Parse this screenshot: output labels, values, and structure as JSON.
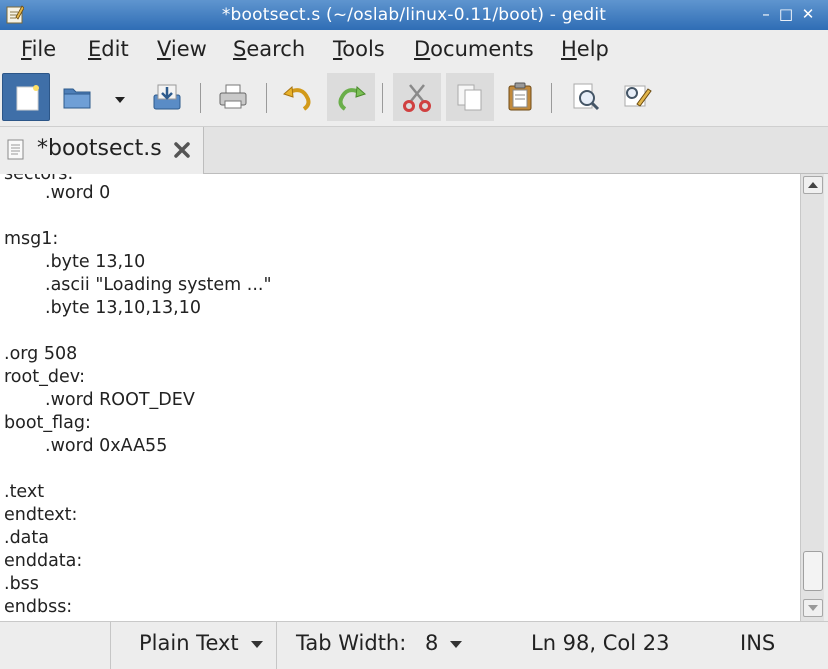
{
  "window": {
    "title": "*bootsect.s (~/oslab/linux-0.11/boot) - gedit",
    "controls": {
      "minimize": "–",
      "maximize": "□",
      "close": "✕"
    }
  },
  "menubar": {
    "items": [
      {
        "id": "file",
        "label": "File",
        "mnemonic": "F",
        "rest": "ile"
      },
      {
        "id": "edit",
        "label": "Edit",
        "mnemonic": "E",
        "rest": "dit"
      },
      {
        "id": "view",
        "label": "View",
        "mnemonic": "V",
        "rest": "iew"
      },
      {
        "id": "search",
        "label": "Search",
        "mnemonic": "S",
        "rest": "earch"
      },
      {
        "id": "tools",
        "label": "Tools",
        "mnemonic": "T",
        "rest": "ools"
      },
      {
        "id": "documents",
        "label": "Documents",
        "mnemonic": "D",
        "rest": "ocuments"
      },
      {
        "id": "help",
        "label": "Help",
        "mnemonic": "H",
        "rest": "elp"
      }
    ]
  },
  "toolbar": {
    "buttons": [
      {
        "id": "new",
        "icon": "new-document-icon",
        "active": true
      },
      {
        "id": "open",
        "icon": "open-folder-icon",
        "active": false
      },
      {
        "id": "open-recent",
        "icon": "dropdown-arrow-icon",
        "active": false
      },
      {
        "id": "save",
        "icon": "save-download-icon",
        "active": false
      },
      {
        "id": "print",
        "icon": "printer-icon",
        "active": false
      },
      {
        "id": "undo",
        "icon": "undo-arrow-icon",
        "active": false
      },
      {
        "id": "redo",
        "icon": "redo-arrow-icon",
        "active": false
      },
      {
        "id": "cut",
        "icon": "scissors-icon",
        "active": false
      },
      {
        "id": "copy",
        "icon": "copy-icon",
        "active": false
      },
      {
        "id": "paste",
        "icon": "clipboard-icon",
        "active": false
      },
      {
        "id": "find",
        "icon": "magnifier-icon",
        "active": false
      },
      {
        "id": "replace",
        "icon": "find-replace-icon",
        "active": false
      }
    ]
  },
  "tab": {
    "label": "*bootsect.s",
    "icon": "text-file-icon",
    "close_icon": "close-x-icon"
  },
  "editor": {
    "partial_top_line": "sectors:",
    "lines": [
      {
        "text": ".word 0",
        "indent": true
      },
      {
        "text": "",
        "indent": false
      },
      {
        "text": "msg1:",
        "indent": false
      },
      {
        "text": ".byte 13,10",
        "indent": true
      },
      {
        "text": ".ascii \"Loading system ...\"",
        "indent": true
      },
      {
        "text": ".byte 13,10,13,10",
        "indent": true
      },
      {
        "text": "",
        "indent": false
      },
      {
        "text": ".org 508",
        "indent": false
      },
      {
        "text": "root_dev:",
        "indent": false
      },
      {
        "text": ".word ROOT_DEV",
        "indent": true
      },
      {
        "text": "boot_flag:",
        "indent": false
      },
      {
        "text": ".word 0xAA55",
        "indent": true
      },
      {
        "text": "",
        "indent": false
      },
      {
        "text": ".text",
        "indent": false
      },
      {
        "text": "endtext:",
        "indent": false
      },
      {
        "text": ".data",
        "indent": false
      },
      {
        "text": "enddata:",
        "indent": false
      },
      {
        "text": ".bss",
        "indent": false
      },
      {
        "text": "endbss:",
        "indent": false
      }
    ],
    "scroll_position_fraction": 0.985
  },
  "statusbar": {
    "language": "Plain Text",
    "tab_width_label": "Tab Width:",
    "tab_width_value": "8",
    "cursor": "Ln 98, Col 23",
    "mode": "INS"
  },
  "colors": {
    "titlebar": "#3a78bf",
    "chrome": "#ededed",
    "editor_bg": "#ffffff",
    "text": "#222222"
  }
}
